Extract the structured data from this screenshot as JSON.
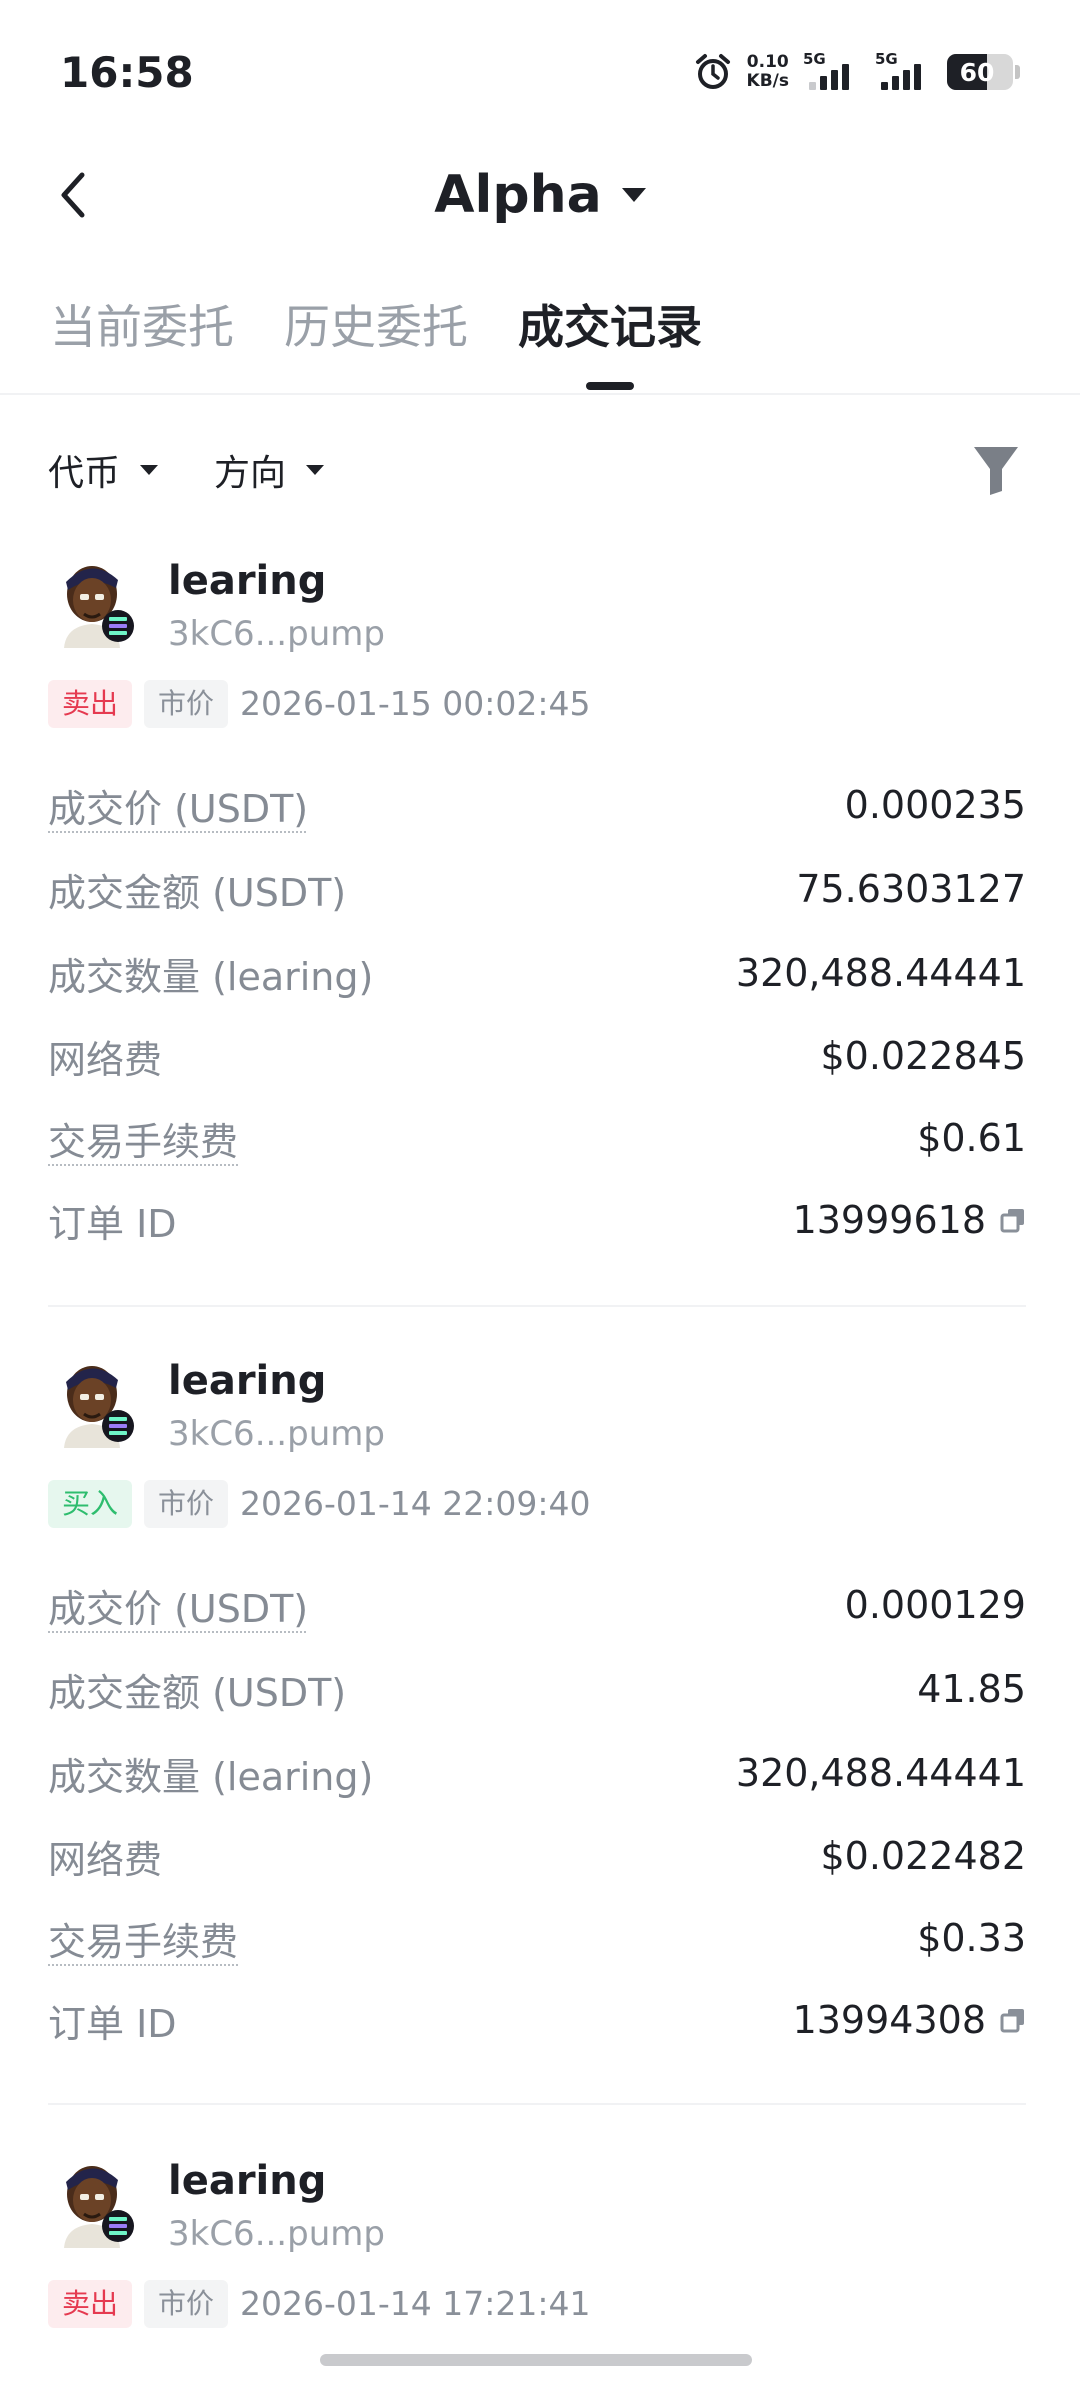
{
  "status_bar": {
    "time": "16:58",
    "speed_value": "0.10",
    "speed_unit": "KB/s",
    "net1": "5G",
    "net2": "5G",
    "battery": "60"
  },
  "header": {
    "title": "Alpha"
  },
  "tabs": [
    {
      "label": "当前委托"
    },
    {
      "label": "历史委托"
    },
    {
      "label": "成交记录"
    }
  ],
  "filters": {
    "coin": "代币",
    "direction": "方向"
  },
  "trades": [
    {
      "name": "learing",
      "address": "3kC6...pump",
      "side": "卖出",
      "order_type": "市价",
      "time": "2026-01-15 00:02:45",
      "rows": [
        {
          "label": "成交价 (USDT)",
          "value": "0.000235"
        },
        {
          "label": "成交金额 (USDT)",
          "value": "75.6303127"
        },
        {
          "label": "成交数量 (learing)",
          "value": "320,488.44441"
        },
        {
          "label": "网络费",
          "value": "$0.022845"
        },
        {
          "label": "交易手续费",
          "value": "$0.61"
        },
        {
          "label": "订单 ID",
          "value": "13999618"
        }
      ]
    },
    {
      "name": "learing",
      "address": "3kC6...pump",
      "side": "买入",
      "order_type": "市价",
      "time": "2026-01-14 22:09:40",
      "rows": [
        {
          "label": "成交价 (USDT)",
          "value": "0.000129"
        },
        {
          "label": "成交金额 (USDT)",
          "value": "41.85"
        },
        {
          "label": "成交数量 (learing)",
          "value": "320,488.44441"
        },
        {
          "label": "网络费",
          "value": "$0.022482"
        },
        {
          "label": "交易手续费",
          "value": "$0.33"
        },
        {
          "label": "订单 ID",
          "value": "13994308"
        }
      ]
    },
    {
      "name": "learing",
      "address": "3kC6...pump",
      "side": "卖出",
      "order_type": "市价",
      "time": "2026-01-14 17:21:41"
    }
  ],
  "colors": {
    "sell": "#e53a50",
    "buy": "#2ebd6e",
    "text": "#1e2026",
    "muted": "#858b94"
  },
  "icons": [
    "back-arrow-icon",
    "caret-down-icon",
    "filter-icon",
    "copy-icon",
    "solana-icon",
    "alarm-icon"
  ]
}
